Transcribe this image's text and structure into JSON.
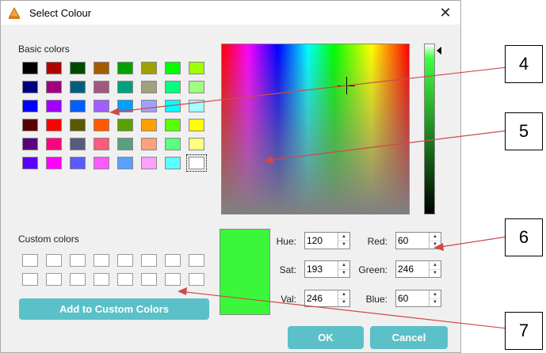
{
  "window": {
    "title": "Select Colour",
    "close_glyph": "✕",
    "icon": "app-icon"
  },
  "basic_colors": {
    "label": "Basic colors",
    "rows": [
      [
        "#000000",
        "#b00000",
        "#004a00",
        "#a65a00",
        "#00a000",
        "#a0a000",
        "#00ff00",
        "#a0ff00"
      ],
      [
        "#00007f",
        "#a0007f",
        "#005f7f",
        "#a0587f",
        "#00a07f",
        "#a0a07f",
        "#00ff7f",
        "#a0ff7f"
      ],
      [
        "#0000ff",
        "#a000ff",
        "#005fff",
        "#a05fff",
        "#00a0ff",
        "#a0a0ff",
        "#00ffff",
        "#a0ffff"
      ],
      [
        "#5a0000",
        "#ff0000",
        "#5a5a00",
        "#ff5a00",
        "#5aa000",
        "#ffa000",
        "#5aff00",
        "#ffff00"
      ],
      [
        "#5a007f",
        "#ff007f",
        "#5a5a7f",
        "#ff5a7f",
        "#5aa07f",
        "#ffa07f",
        "#5aff7f",
        "#ffff7f"
      ],
      [
        "#5a00ff",
        "#ff00ff",
        "#5a5aff",
        "#ff5aff",
        "#5aa0ff",
        "#ffa0ff",
        "#5affff",
        "#ffffff"
      ]
    ]
  },
  "custom_colors": {
    "label": "Custom colors",
    "rows": 2,
    "cols": 8
  },
  "add_button": "Add to Custom Colors",
  "fields": {
    "hue": {
      "label": "Hue:",
      "value": "120"
    },
    "sat": {
      "label": "Sat:",
      "value": "193"
    },
    "val": {
      "label": "Val:",
      "value": "246"
    },
    "red": {
      "label": "Red:",
      "value": "60"
    },
    "green": {
      "label": "Green:",
      "value": "246"
    },
    "blue": {
      "label": "Blue:",
      "value": "60"
    }
  },
  "spinner_glyphs": {
    "up": "▲",
    "down": "▼"
  },
  "current_color": "#3cf63c",
  "ok_button": "OK",
  "cancel_button": "Cancel",
  "callouts": [
    "4",
    "5",
    "6",
    "7"
  ],
  "annotation_color": "#d14848"
}
